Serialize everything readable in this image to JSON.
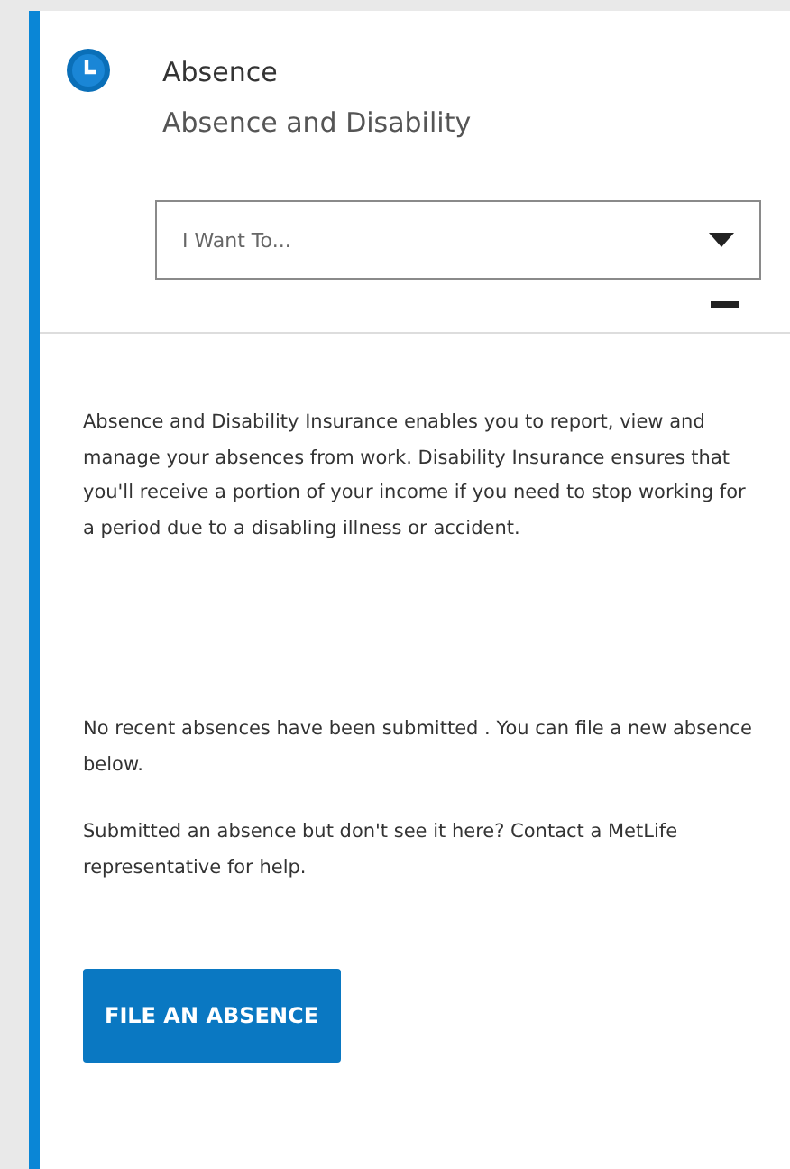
{
  "card": {
    "title": "Absence",
    "subtitle": "Absence and Disability"
  },
  "dropdown": {
    "placeholder": "I Want To..."
  },
  "paragraphs": [
    "Absence and Disability Insurance enables you to report, view and manage your absences from work. Disability Insurance ensures that you'll receive a portion of your income if you need to stop working for a period due to a disabling illness or accident.",
    "No recent absences have been submitted . You can file a new absence below.",
    "Submitted an absence but don't see it here? Contact a MetLife representative for help."
  ],
  "button": "FILE AN ABSENCE"
}
